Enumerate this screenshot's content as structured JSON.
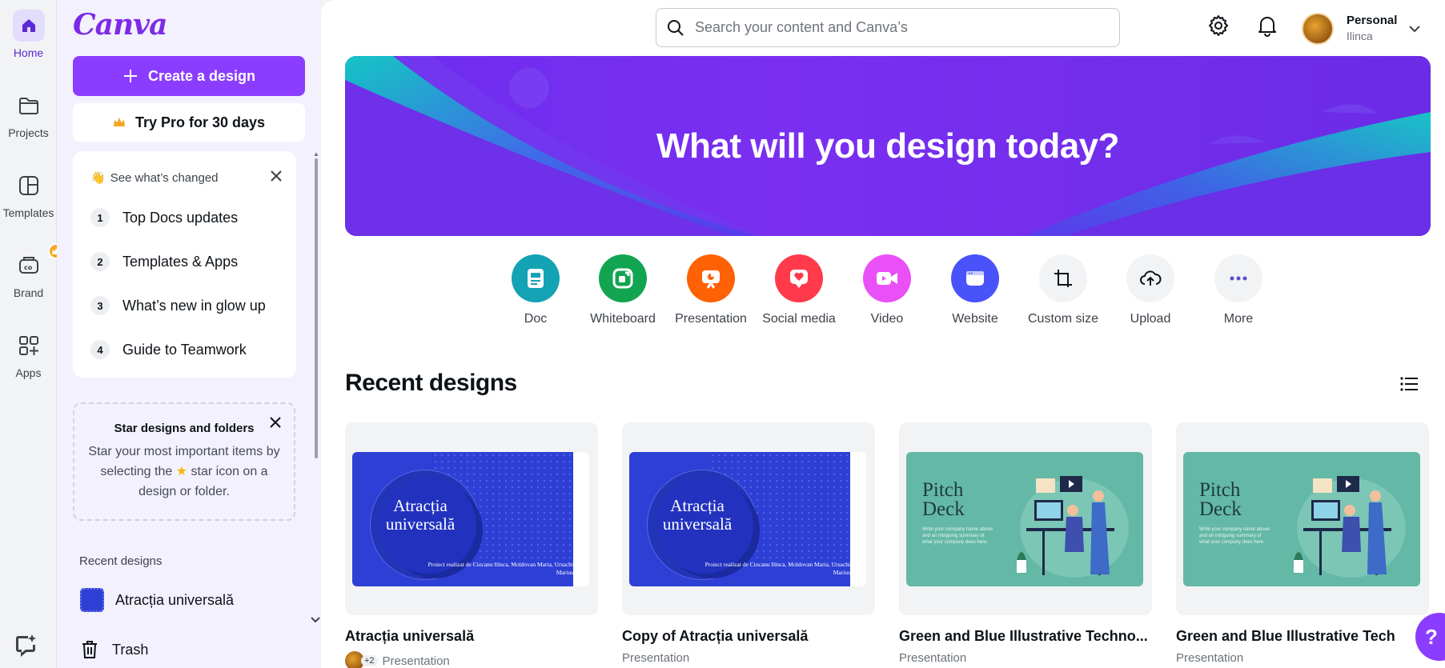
{
  "rail": {
    "home": "Home",
    "projects": "Projects",
    "templates": "Templates",
    "brand": "Brand",
    "apps": "Apps"
  },
  "panel": {
    "logo": "Canva",
    "create_label": "Create a design",
    "pro_label": "Try Pro for 30 days",
    "changes": {
      "heading": "See what’s changed",
      "items": [
        {
          "num": "1",
          "label": "Top Docs updates"
        },
        {
          "num": "2",
          "label": "Templates & Apps"
        },
        {
          "num": "3",
          "label": "What’s new in glow up"
        },
        {
          "num": "4",
          "label": "Guide to Teamwork"
        }
      ]
    },
    "star": {
      "title": "Star designs and folders",
      "desc_before": "Star your most important items by selecting the",
      "desc_after": "star icon on a design or folder."
    },
    "recent_label": "Recent designs",
    "recent_item": "Atracția universală",
    "trash_label": "Trash"
  },
  "header": {
    "search_placeholder": "Search your content and Canva’s",
    "account_name": "Personal",
    "account_user": "Ilinca"
  },
  "banner": {
    "title": "What will you design today?"
  },
  "content_types": [
    {
      "label": "Doc",
      "color": "#13a3b5",
      "icon": "doc-icon"
    },
    {
      "label": "Whiteboard",
      "color": "#13a452",
      "icon": "whiteboard-icon"
    },
    {
      "label": "Presentation",
      "color": "#ff6105",
      "icon": "presentation-icon"
    },
    {
      "label": "Social media",
      "color": "#ff3b4b",
      "icon": "social-media-icon"
    },
    {
      "label": "Video",
      "color": "#e950f7",
      "icon": "video-icon"
    },
    {
      "label": "Website",
      "color": "#4a53fa",
      "icon": "website-icon"
    },
    {
      "label": "Custom size",
      "color": "#f2f3f5",
      "icon": "custom-size-icon"
    },
    {
      "label": "Upload",
      "color": "#f2f3f5",
      "icon": "upload-icon"
    },
    {
      "label": "More",
      "color": "#f2f3f5",
      "icon": "more-icon"
    }
  ],
  "recent": {
    "title": "Recent designs",
    "designs": [
      {
        "name": "Atracția universală",
        "type": "Presentation",
        "thumb_title": "Atracția universală",
        "thumb_small": "Proiect realizat de Ciocanu Ilinca, Moldovan Maria, Ursachi Marius",
        "collab_count": "+2"
      },
      {
        "name": "Copy of Atracția universală",
        "type": "Presentation",
        "thumb_title": "Atracția universală",
        "thumb_small": "Proiect realizat de Ciocanu Ilinca, Moldovan Maria, Ursachi Marius"
      },
      {
        "name": "Green and Blue Illustrative Techno...",
        "type": "Presentation",
        "thumb_title": "Pitch Deck",
        "thumb_small": "Write your company name above and an intriguing summary of what your company does here."
      },
      {
        "name": "Green and Blue Illustrative Tech",
        "type": "Presentation",
        "thumb_title": "Pitch Deck",
        "thumb_small": "Write your company name above and an intriguing summary of what your company does here."
      }
    ]
  },
  "help_label": "?"
}
